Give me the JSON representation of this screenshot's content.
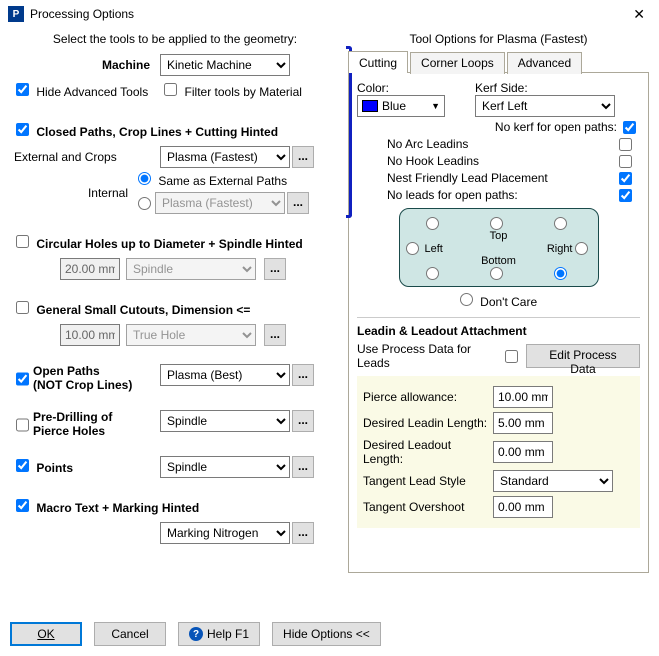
{
  "window": {
    "title": "Processing Options"
  },
  "left": {
    "instruction": "Select the tools to be applied to the geometry:",
    "machine_label": "Machine",
    "machine_value": "Kinetic Machine",
    "hide_adv_label": "Hide Advanced Tools",
    "hide_adv_checked": true,
    "filter_mat_label": "Filter tools by Material",
    "filter_mat_checked": false,
    "closed_paths_label": "Closed Paths,  Crop Lines  +  Cutting Hinted",
    "closed_paths_checked": true,
    "external_label": "External and Crops",
    "external_value": "Plasma (Fastest)",
    "internal_label": "Internal",
    "internal_same_label": "Same as External Paths",
    "internal_alt_value": "Plasma (Fastest)",
    "circ_label": "Circular Holes up to Diameter   +  Spindle Hinted",
    "circ_checked": false,
    "circ_diam": "20.00 mm",
    "circ_tool": "Spindle",
    "small_label": "General Small Cutouts, Dimension <=",
    "small_checked": false,
    "small_dim": "10.00 mm",
    "small_tool": "True Hole",
    "open_label_1": "Open Paths",
    "open_label_2": "(NOT Crop Lines)",
    "open_checked": true,
    "open_tool": "Plasma (Best)",
    "pre_label_1": "Pre-Drilling of",
    "pre_label_2": "Pierce Holes",
    "pre_checked": false,
    "pre_tool": "Spindle",
    "points_label": "Points",
    "points_checked": true,
    "points_tool": "Spindle",
    "macro_label": "Macro Text   +  Marking Hinted",
    "macro_checked": true,
    "macro_tool": "Marking Nitrogen"
  },
  "right": {
    "title": "Tool Options for Plasma (Fastest)",
    "tabs": {
      "cutting": "Cutting",
      "corner": "Corner Loops",
      "advanced": "Advanced"
    },
    "color_label": "Color:",
    "color_name": "Blue",
    "kerf_label": "Kerf Side:",
    "kerf_value": "Kerf Left",
    "no_kerf_label": "No kerf for open paths:",
    "no_arc_label": "No Arc Leadins",
    "no_hook_label": "No Hook Leadins",
    "nest_friendly_label": "Nest Friendly Lead Placement",
    "no_leads_open_label": "No leads for open paths:",
    "pos_top": "Top",
    "pos_left": "Left",
    "pos_right": "Right",
    "pos_bottom": "Bottom",
    "dont_care": "Don't Care",
    "leadin_section": "Leadin & Leadout Attachment",
    "use_process_label": "Use Process Data for Leads",
    "edit_process_btn": "Edit Process Data",
    "pierce_label": "Pierce allowance:",
    "pierce_val": "10.00 mm",
    "leadin_len_label": "Desired Leadin Length:",
    "leadin_len_val": "5.00 mm",
    "leadout_len_label": "Desired Leadout Length:",
    "leadout_len_val": "0.00 mm",
    "tangent_style_label": "Tangent Lead Style",
    "tangent_style_val": "Standard",
    "tangent_over_label": "Tangent Overshoot",
    "tangent_over_val": "0.00 mm"
  },
  "footer": {
    "ok": "OK",
    "cancel": "Cancel",
    "help": "Help F1",
    "hide": "Hide Options <<"
  }
}
